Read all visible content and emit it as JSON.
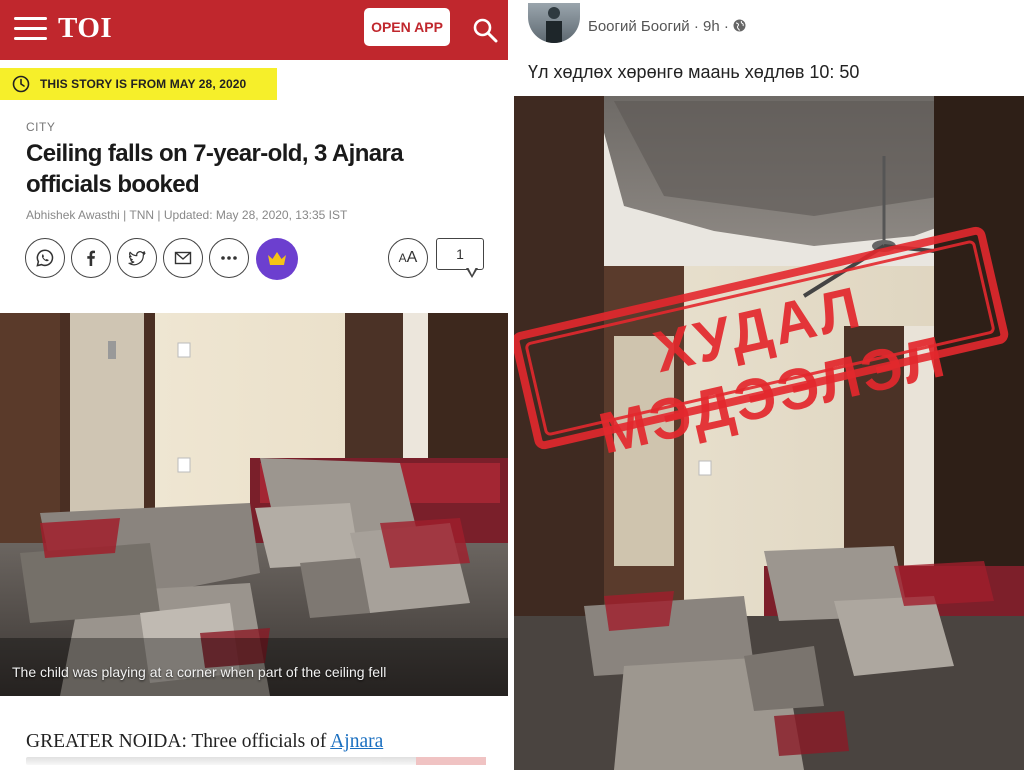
{
  "toi": {
    "logo": "TOI",
    "open_app": "OPEN APP",
    "date_banner": "THIS STORY IS FROM MAY 28, 2020",
    "section": "CITY",
    "headline_line1": "Ceiling falls on 7-year-old, 3 Ajnara",
    "headline_line2": "officials booked",
    "byline": "Abhishek Awasthi | TNN | Updated: May 28, 2020, 13:35 IST",
    "font_size_label_small": "A",
    "font_size_label_large": "A",
    "comment_count": "1",
    "photo_caption": "The child was playing at a corner when part of the ceiling fell",
    "body_prefix": "GREATER NOIDA: Three officials of ",
    "body_link": "Ajnara",
    "share_icons": [
      "whatsapp-icon",
      "facebook-icon",
      "twitter-icon",
      "email-icon",
      "more-icon"
    ]
  },
  "fb": {
    "author": "Боогий Боогий",
    "meta": " · 9h · ",
    "post_text": "Үл хөдлөх хөрөнгө маань хөдлөв 10: 50",
    "stamp_text": "ХУДАЛ МЭДЭЭЛЭЛ"
  },
  "colors": {
    "toi_red": "#c0272d",
    "banner_yellow": "#f6ef2a",
    "crown_purple": "#6c3fcf",
    "stamp_red": "#e3282d",
    "link_blue": "#1a6fc0"
  }
}
